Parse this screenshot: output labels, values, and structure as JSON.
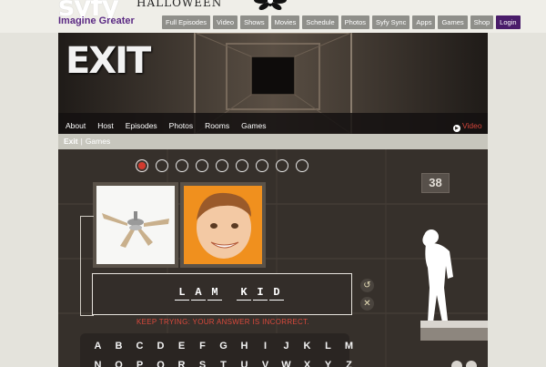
{
  "site": {
    "logo": "syfy",
    "tagline": "Imagine Greater",
    "promo": "HALLOWEEN",
    "nav": [
      {
        "label": "Full Episodes"
      },
      {
        "label": "Video"
      },
      {
        "label": "Shows"
      },
      {
        "label": "Movies"
      },
      {
        "label": "Schedule"
      },
      {
        "label": "Photos"
      },
      {
        "label": "Syfy Sync"
      },
      {
        "label": "Apps"
      },
      {
        "label": "Games"
      },
      {
        "label": "Shop"
      },
      {
        "label": "Login"
      }
    ]
  },
  "show": {
    "title": "EXIT",
    "subnav": [
      "About",
      "Host",
      "Episodes",
      "Photos",
      "Rooms",
      "Games"
    ],
    "video_label": "Video"
  },
  "breadcrumb": {
    "current": "Exit",
    "separator": "|",
    "link": "Games"
  },
  "game": {
    "timer": "38",
    "progress_total": 9,
    "progress_active": 1,
    "answer_words": [
      [
        "L",
        "A",
        "M"
      ],
      [
        "K",
        "I",
        "D"
      ]
    ],
    "feedback": "KEEP TRYING: YOUR ANSWER IS INCORRECT.",
    "keyboard_row1": [
      "A",
      "B",
      "C",
      "D",
      "E",
      "F",
      "G",
      "H",
      "I",
      "J",
      "K",
      "L",
      "M"
    ],
    "keyboard_row2": [
      "N",
      "O",
      "P",
      "Q",
      "R",
      "S",
      "T",
      "U",
      "V",
      "W",
      "X",
      "Y",
      "Z"
    ],
    "colors": {
      "accent_red": "#d23a2e",
      "feedback_red": "#d9493c",
      "brand_purple": "#5b2a83"
    }
  }
}
